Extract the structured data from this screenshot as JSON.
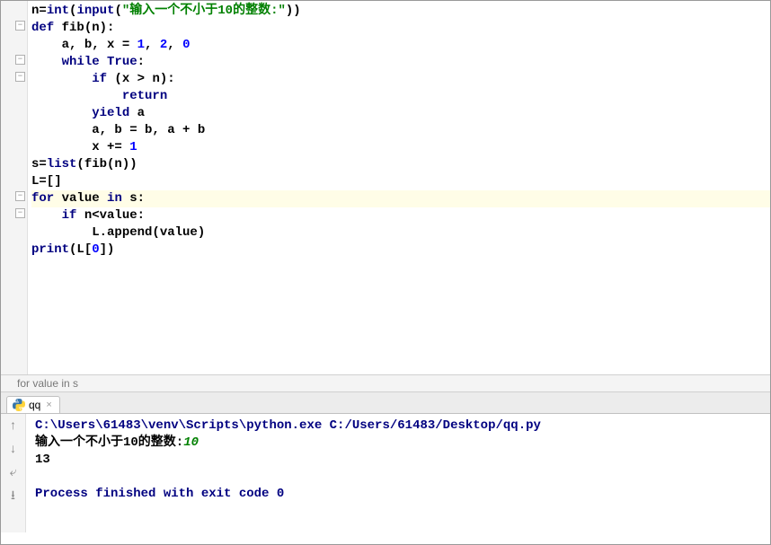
{
  "code": {
    "line1": {
      "pre": "",
      "builtin1": "n",
      "eq": "=",
      "int": "int",
      "p1": "(",
      "input": "input",
      "p2": "(",
      "str": "\"输入一个不小于10的整数:\"",
      "p3": "))"
    },
    "line2": {
      "pre": "",
      "def": "def",
      "sp": " ",
      "name": "fib",
      "p": "(n):"
    },
    "line3": {
      "pre": "    ",
      "txt": "a, b, x = ",
      "n1": "1",
      "c1": ", ",
      "n2": "2",
      "c2": ", ",
      "n3": "0"
    },
    "line4": {
      "pre": "    ",
      "while": "while",
      "sp": " ",
      "true": "True",
      "colon": ":"
    },
    "line5": {
      "pre": "        ",
      "if": "if",
      "rest": " (x > n):"
    },
    "line6": {
      "pre": "            ",
      "return": "return"
    },
    "line7": {
      "pre": "        ",
      "yield": "yield",
      "rest": " a"
    },
    "line8": {
      "pre": "        ",
      "txt": "a, b = b, a + b"
    },
    "line9": {
      "pre": "        ",
      "txt": "x += ",
      "n": "1"
    },
    "line10": {
      "pre": "",
      "txt": "s=",
      "list": "list",
      "rest": "(fib(n))"
    },
    "line11": {
      "pre": "",
      "txt": "L=[]"
    },
    "line12": {
      "pre": "",
      "for": "for",
      "sp1": " ",
      "val": "value",
      "sp2": " ",
      "in": "in",
      "rest": " s:"
    },
    "line13": {
      "pre": "    ",
      "if": "if",
      "rest": " n<value:"
    },
    "line14": {
      "pre": "        ",
      "txt": "L.append(value)"
    },
    "line15": {
      "pre": "",
      "print": "print",
      "p1": "(L[",
      "n": "0",
      "p2": "])"
    }
  },
  "breadcrumb": "for value in s",
  "run": {
    "tab_label": "qq",
    "path": "C:\\Users\\61483\\venv\\Scripts\\python.exe C:/Users/61483/Desktop/qq.py",
    "prompt": "输入一个不小于10的整数:",
    "user_input": "10",
    "output": "13",
    "exit": "Process finished with exit code 0"
  }
}
